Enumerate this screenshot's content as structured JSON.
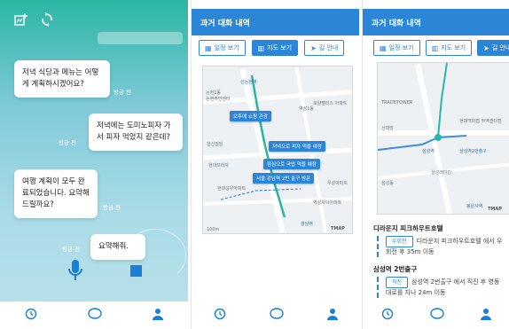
{
  "chat": {
    "messages": [
      {
        "text": "저녁 식당과 메뉴는 어떻게 계획하시겠어요?",
        "time": "방금 전",
        "side": "left"
      },
      {
        "text": "저녁에는 도미노피자 가서 피자 먹었지 같은데?",
        "time": "방금 전",
        "side": "right"
      },
      {
        "text": "여행 계획이 모두 완료되었습니다. 요약해드릴까요?",
        "time": "방금 전",
        "side": "left"
      },
      {
        "text": "요약해줘.",
        "time": "방금 전",
        "side": "right"
      }
    ],
    "icons": {
      "add": "add-note-icon",
      "refresh": "refresh-icon",
      "mic": "microphone-icon",
      "stop": "stop-icon"
    }
  },
  "history": {
    "title": "과거 대화 내역",
    "tabs": [
      {
        "label": "일정 보기",
        "icon": "calendar-icon"
      },
      {
        "label": "지도 보기",
        "icon": "map-icon"
      },
      {
        "label": "길 안내",
        "icon": "navigation-icon"
      }
    ],
    "map_pins": [
      "오후에 쇼핑 관광",
      "저녁으로 피자 먹을 예정",
      "점심으로 국밥 먹을 예정",
      "서울 강남역 2번 출구 방문"
    ],
    "map_labels": [
      "신논현역",
      "신논현역",
      "논현1동",
      "논현주민센터",
      "역삼1동",
      "로얄팰리스 아파트",
      "한신빌딩",
      "현대프라자",
      "현대성우아파트",
      "강남역",
      "역삼자이아파트",
      "우성아파트",
      "삼성",
      "선"
    ],
    "map_brand": "TMAP",
    "map_scale": "100m"
  },
  "guide": {
    "map_labels": [
      "TRADETOWER",
      "신대방",
      "삼성역",
      "삼성역2번출구",
      "현대백화점 무역센터점",
      "삼성동",
      "삼성래미안",
      "코엑스몰",
      "봉은사역"
    ],
    "map_brand": "TMAP",
    "places": [
      {
        "name": "디라운지 피크하우트호텔",
        "badge": "우회전",
        "desc": "디라운지 피크하우트호텔 에서 우회전 후 35m 이동"
      },
      {
        "name": "삼성역 2번출구",
        "badge": "직진",
        "desc": "삼성역 2번출구 에서 직진 후 영동대로를 지나 24m 이동"
      }
    ]
  },
  "nav": {
    "items": [
      {
        "icon": "history-icon"
      },
      {
        "icon": "chat-icon"
      },
      {
        "icon": "profile-icon"
      }
    ]
  },
  "colors": {
    "accent": "#2c86d8",
    "teal": "#2bb6a3"
  }
}
